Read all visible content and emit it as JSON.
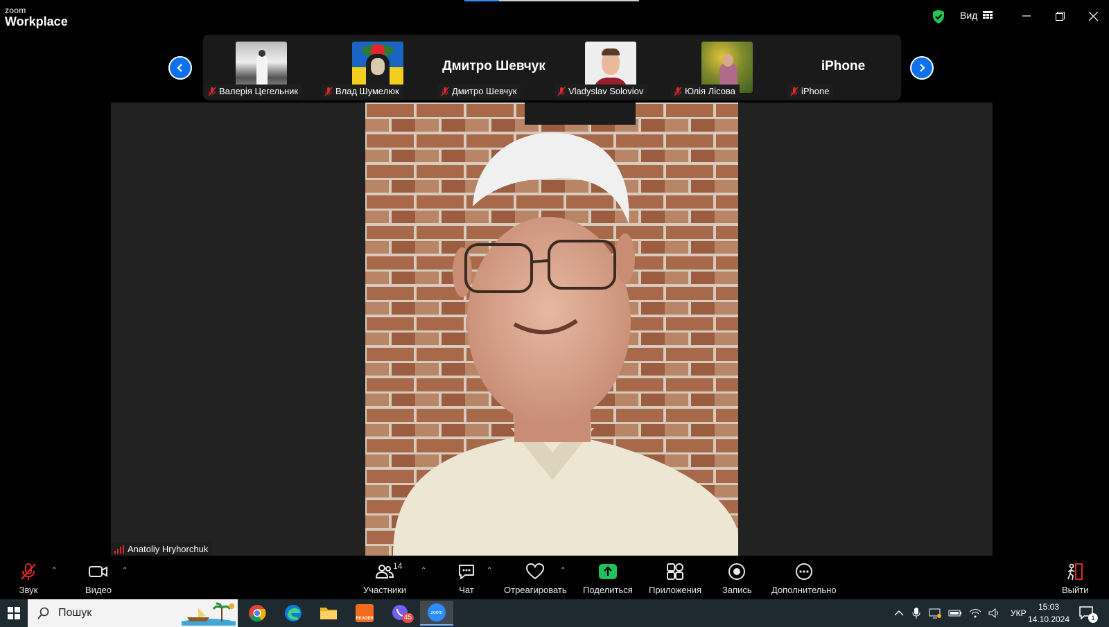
{
  "app": {
    "logo_small": "zoom",
    "logo_big": "Workplace"
  },
  "titlebar": {
    "view_label": "Вид"
  },
  "participants": [
    {
      "name": "Валерія Цегельник",
      "has_photo": true
    },
    {
      "name": "Влад Шумелюк",
      "has_photo": true
    },
    {
      "name": "Дмитро Шевчук",
      "has_photo": false,
      "display_text": "Дмитро Шевчук"
    },
    {
      "name": "Vladyslav Soloviov",
      "has_photo": true
    },
    {
      "name": "Юлія Лісова",
      "has_photo": true
    },
    {
      "name": "iPhone",
      "has_photo": false,
      "display_text": "iPhone"
    }
  ],
  "speaker": {
    "name": "Anatoliy Hryhorchuk"
  },
  "toolbar": {
    "audio": "Звук",
    "video": "Видео",
    "participants": "Участники",
    "participants_count": "14",
    "chat": "Чат",
    "react": "Отреагировать",
    "share": "Поделиться",
    "apps": "Приложения",
    "record": "Запись",
    "more": "Дополнительно",
    "leave": "Выйти"
  },
  "taskbar": {
    "search_placeholder": "Пошук",
    "viber_badge": "45",
    "reader_label": "READER",
    "zoom_label": "zoom",
    "language": "УКР",
    "time": "15:03",
    "date": "14.10.2024",
    "notifications": "1"
  },
  "colors": {
    "accent": "#0e71eb",
    "share_green": "#1fc35c",
    "mic_off_red": "#e02828",
    "leave_red": "#e02828"
  }
}
